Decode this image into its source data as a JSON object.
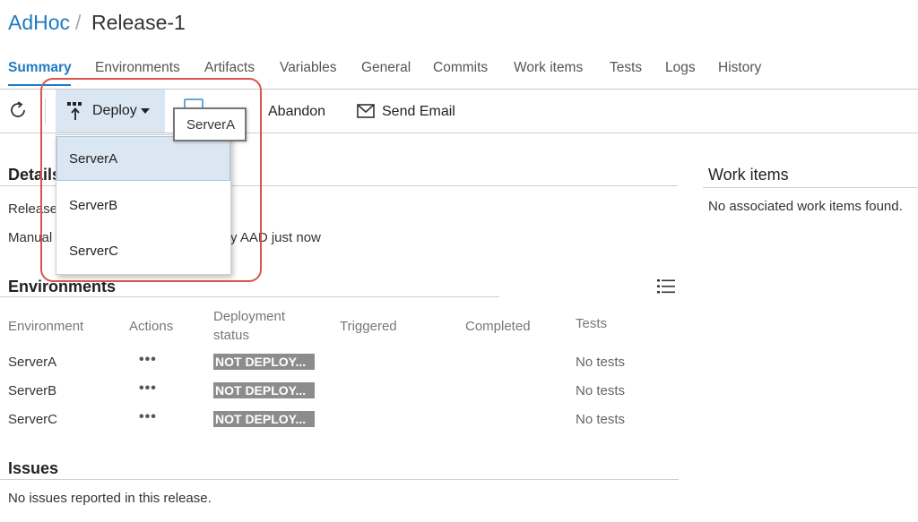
{
  "breadcrumb": {
    "project": "AdHoc",
    "separator": "/",
    "release": "Release-1"
  },
  "tabs": [
    {
      "label": "Summary",
      "active": true
    },
    {
      "label": "Environments"
    },
    {
      "label": "Artifacts"
    },
    {
      "label": "Variables"
    },
    {
      "label": "General"
    },
    {
      "label": "Commits"
    },
    {
      "label": "Work items"
    },
    {
      "label": "Tests"
    },
    {
      "label": "Logs"
    },
    {
      "label": "History"
    }
  ],
  "toolbar": {
    "refresh_icon": "refresh-icon",
    "deploy_label": "Deploy",
    "abandon_label": "Abandon",
    "send_email_label": "Send Email"
  },
  "tooltip": {
    "text": "ServerA"
  },
  "deploy_menu": {
    "items": [
      {
        "label": "ServerA",
        "selected": true
      },
      {
        "label": "ServerB"
      },
      {
        "label": "ServerC"
      }
    ]
  },
  "details": {
    "title": "Details",
    "release_label": "Release",
    "manual_label": "Manual",
    "manual_tail": "sky AAD just now"
  },
  "work_items": {
    "title": "Work items",
    "empty": "No associated work items found."
  },
  "environments": {
    "title": "Environments",
    "columns": {
      "environment": "Environment",
      "actions": "Actions",
      "deployment_status_1": "Deployment",
      "deployment_status_2": "status",
      "triggered": "Triggered",
      "completed": "Completed",
      "tests": "Tests"
    },
    "rows": [
      {
        "name": "ServerA",
        "actions": "•••",
        "status": "NOT DEPLOY...",
        "tests": "No tests"
      },
      {
        "name": "ServerB",
        "actions": "•••",
        "status": "NOT DEPLOY...",
        "tests": "No tests"
      },
      {
        "name": "ServerC",
        "actions": "•••",
        "status": "NOT DEPLOY...",
        "tests": "No tests"
      }
    ]
  },
  "issues": {
    "title": "Issues",
    "empty": "No issues reported in this release."
  },
  "colors": {
    "accent": "#1e7bc3",
    "selection": "#dbe6f3",
    "highlight": "#d9534f",
    "status_badge": "#8c8c8c"
  }
}
